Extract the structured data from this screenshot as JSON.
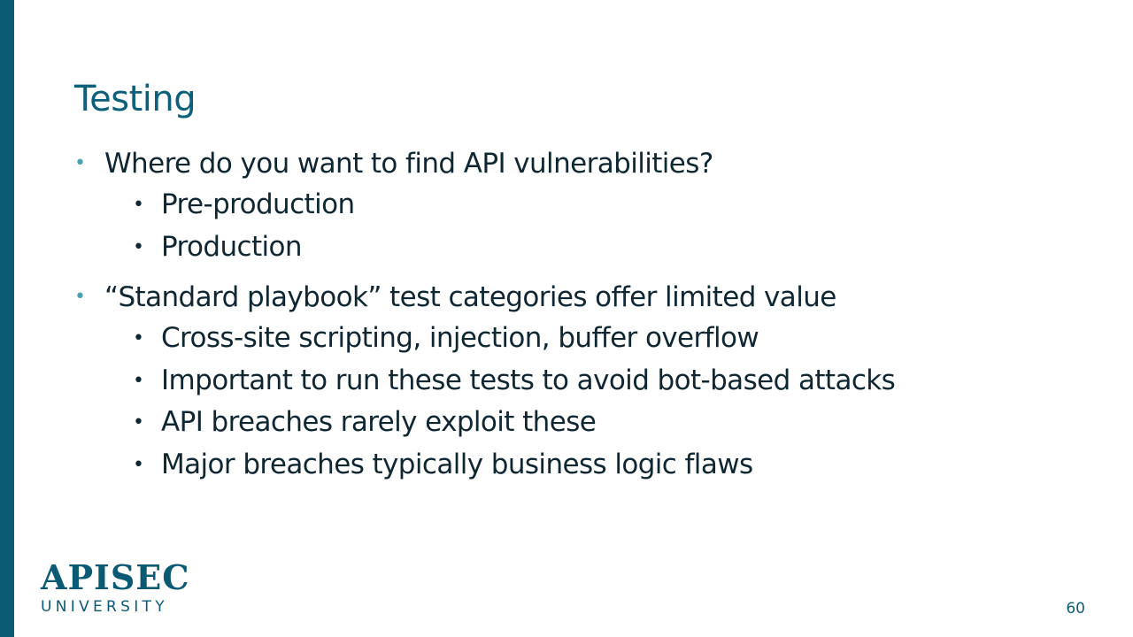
{
  "slide": {
    "title": "Testing",
    "bullets": [
      {
        "text": "Where do you want to find API vulnerabilities?",
        "sub": [
          "Pre-production",
          "Production"
        ]
      },
      {
        "text": "“Standard playbook” test categories offer limited value",
        "sub": [
          "Cross-site scripting, injection, buffer overflow",
          "Important to run these tests to avoid bot-based attacks",
          "API breaches rarely exploit these",
          "Major breaches typically business logic flaws"
        ]
      }
    ],
    "page_number": "60"
  },
  "logo": {
    "main": "APISEC",
    "sub": "UNIVERSITY"
  },
  "colors": {
    "accent_bar": "#0b5a73",
    "title": "#0d607c",
    "body_text": "#0f2733",
    "level1_bullet": "#4ba3b0"
  }
}
